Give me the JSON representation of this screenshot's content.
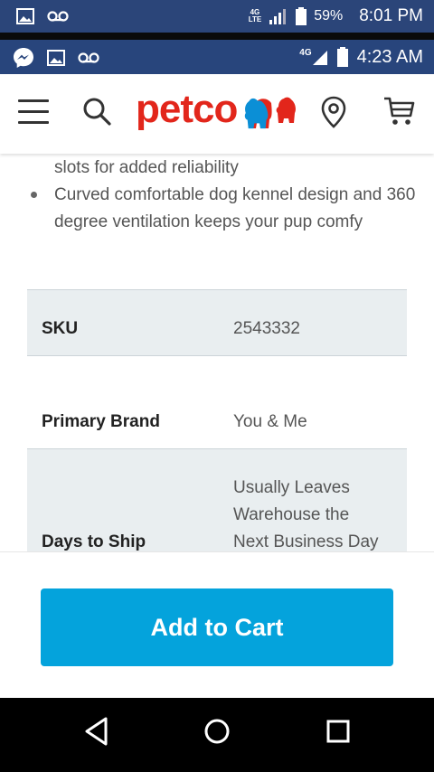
{
  "outer_status_bar": {
    "network_label": "4G\nLTE",
    "battery_percent": "59%",
    "time": "8:01 PM"
  },
  "inner_status_bar": {
    "network_label": "4G",
    "time": "4:23 AM"
  },
  "header": {
    "logo_text": "petco"
  },
  "description": {
    "bullets": [
      "slots for added reliability",
      "Curved comfortable dog kennel design and 360 degree ventilation keeps your pup comfy"
    ]
  },
  "specs": [
    {
      "label": "SKU",
      "value": "2543332"
    },
    {
      "label": "Primary Brand",
      "value": "You & Me"
    },
    {
      "label": "Days to Ship",
      "value": "Usually Leaves Warehouse the Next Business Day"
    }
  ],
  "add_to_cart": {
    "label": "Add to Cart",
    "color": "#04a3dc"
  },
  "colors": {
    "brand_red": "#e2261b",
    "status_bar": "#2b4579"
  }
}
